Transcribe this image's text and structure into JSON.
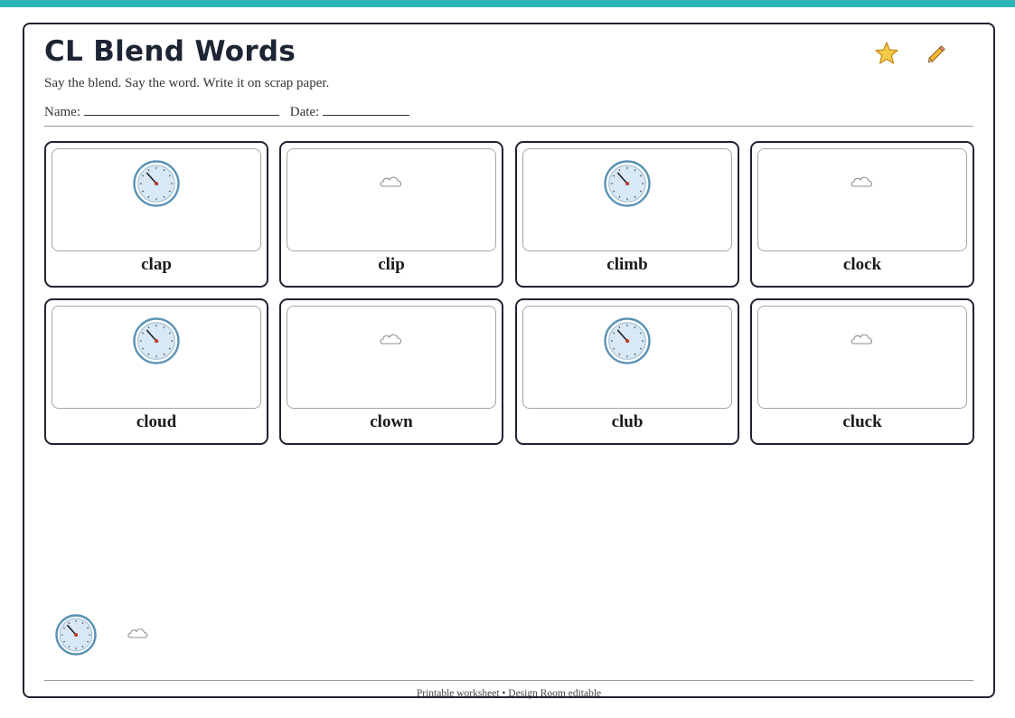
{
  "worksheet": {
    "title": "CL Blend Words",
    "instructions": "Say the blend. Say the word. Write it on scrap paper.",
    "name_label": "Name:",
    "date_label": "Date:"
  },
  "decorations": [
    "star-icon",
    "pencil-icon"
  ],
  "cards": [
    {
      "word": "clap",
      "icon": "clock-icon"
    },
    {
      "word": "clip",
      "icon": "cloud-icon"
    },
    {
      "word": "climb",
      "icon": "clock-icon"
    },
    {
      "word": "clock",
      "icon": "cloud-icon"
    },
    {
      "word": "cloud",
      "icon": "clock-icon"
    },
    {
      "word": "clown",
      "icon": "cloud-icon"
    },
    {
      "word": "club",
      "icon": "clock-icon"
    },
    {
      "word": "cluck",
      "icon": "cloud-icon"
    }
  ],
  "legend_icons": [
    "clock-icon",
    "cloud-icon"
  ],
  "footer": "Printable worksheet • Design Room editable",
  "colors": {
    "top_bar": "#2bb5b8",
    "border": "#1f2430",
    "clock_face": "#d8e8f5",
    "clock_ring": "#5a93b5"
  }
}
